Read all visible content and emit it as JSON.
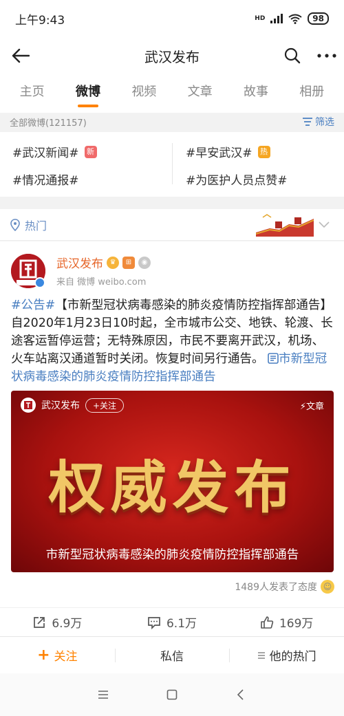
{
  "status": {
    "time": "上午9:43",
    "network": "HD",
    "battery": "98"
  },
  "header": {
    "title": "武汉发布"
  },
  "tabs": [
    {
      "label": "主页",
      "active": false
    },
    {
      "label": "微博",
      "active": true
    },
    {
      "label": "视频",
      "active": false
    },
    {
      "label": "文章",
      "active": false
    },
    {
      "label": "故事",
      "active": false
    },
    {
      "label": "相册",
      "active": false
    }
  ],
  "filter": {
    "count_label": "全部微博(121157)",
    "filter_label": "筛选"
  },
  "topics": [
    {
      "label": "#武汉新闻#",
      "badge": "新"
    },
    {
      "label": "#早安武汉#",
      "badge": "热"
    },
    {
      "label": "#情况通报#",
      "badge": ""
    },
    {
      "label": "#为医护人员点赞#",
      "badge": ""
    }
  ],
  "hot": {
    "label": "热门"
  },
  "post": {
    "author": "武汉发布",
    "source": "来自 微博 weibo.com",
    "tag": "#公告#",
    "text": "【市新型冠状病毒感染的肺炎疫情防控指挥部通告】自2020年1月23日10时起，全市城市公交、地铁、轮渡、长途客运暂停运营；无特殊原因，市民不要离开武汉，机场、火车站离汉通道暂时关闭。恢复时间另行通告。",
    "link": "市新型冠状病毒感染的肺炎疫情防控指挥部通告",
    "article": {
      "author": "武汉发布",
      "follow": "+关注",
      "type": "文章",
      "headline": "权威发布",
      "caption": "市新型冠状病毒感染的肺炎疫情防控指挥部通告"
    },
    "attitude": "1489人发表了态度",
    "repost_count": "6.9万",
    "comment_count": "6.1万",
    "like_count": "169万"
  },
  "bottom": {
    "follow": "关注",
    "message": "私信",
    "hot": "他的热门"
  },
  "colors": {
    "accent": "#ff8200",
    "link": "#4a7fc1",
    "author": "#e6662a"
  }
}
